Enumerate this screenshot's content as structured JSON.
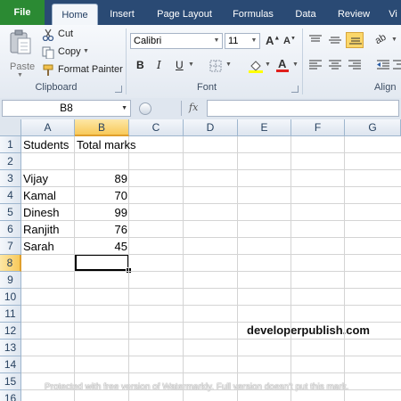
{
  "tabs": [
    "File",
    "Home",
    "Insert",
    "Page Layout",
    "Formulas",
    "Data",
    "Review",
    "Vi"
  ],
  "ribbon": {
    "clipboard": {
      "label": "Clipboard",
      "paste": "Paste",
      "cut": "Cut",
      "copy": "Copy",
      "format_painter": "Format Painter"
    },
    "font": {
      "label": "Font",
      "font_name": "Calibri",
      "font_size": "11",
      "bold": "B",
      "italic": "I",
      "underline": "U",
      "font_color_glyph": "A"
    },
    "alignment": {
      "label": "Align"
    }
  },
  "formula_bar": {
    "name_box": "B8",
    "fx": "fx",
    "formula": ""
  },
  "columns": [
    "A",
    "B",
    "C",
    "D",
    "E",
    "F",
    "G"
  ],
  "rows": [
    "1",
    "2",
    "3",
    "4",
    "5",
    "6",
    "7",
    "8",
    "9",
    "10",
    "11",
    "12",
    "13",
    "14",
    "15",
    "16"
  ],
  "cells": {
    "A1": "Students",
    "B1": "Total marks",
    "A3": "Vijay",
    "B3": "89",
    "A4": "Kamal",
    "B4": "70",
    "A5": "Dinesh",
    "B5": "99",
    "A6": "Ranjith",
    "B6": "76",
    "A7": "Sarah",
    "B7": "45"
  },
  "active_cell": "B8",
  "brand": "developerpublish.com",
  "watermark": "Protected with free version of Watermarkly. Full version doesn't put this mark.",
  "colors": {
    "file_tab": "#2b8a33",
    "tabbar": "#2a4a74",
    "selected_header": "#f8c95a",
    "header_text": "#27415f"
  }
}
